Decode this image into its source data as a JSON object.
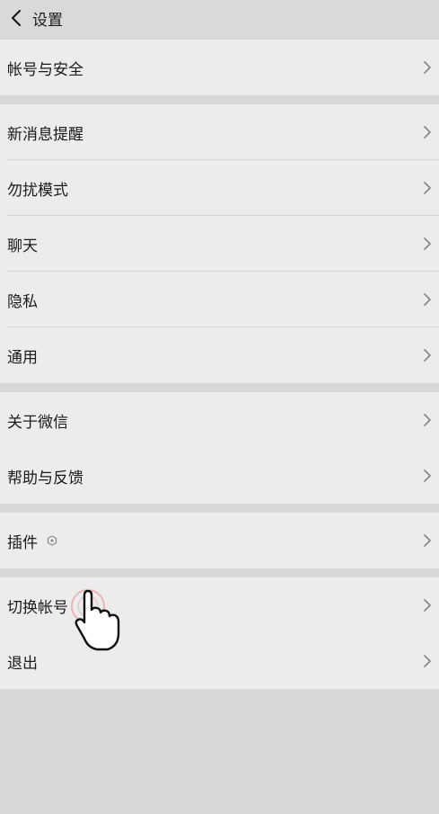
{
  "header": {
    "title": "设置",
    "back_icon": "chevron-left-icon"
  },
  "groups": [
    {
      "items": [
        {
          "label": "帐号与安全"
        }
      ]
    },
    {
      "items": [
        {
          "label": "新消息提醒"
        },
        {
          "label": "勿扰模式"
        },
        {
          "label": "聊天"
        },
        {
          "label": "隐私"
        },
        {
          "label": "通用"
        }
      ]
    },
    {
      "items": [
        {
          "label": "关于微信"
        },
        {
          "label": "帮助与反馈"
        }
      ]
    },
    {
      "items": [
        {
          "label": "插件",
          "icon": "plugin-hexagon-icon"
        }
      ]
    },
    {
      "items": [
        {
          "label": "切换帐号"
        },
        {
          "label": "退出"
        }
      ]
    }
  ],
  "colors": {
    "background": "#d8d8d8",
    "cell": "#ececec",
    "text": "#1a1a1a",
    "chevron": "#8a8a8a"
  }
}
